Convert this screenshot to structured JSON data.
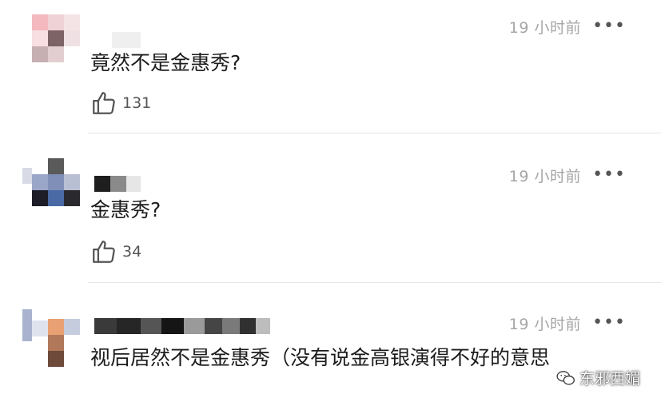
{
  "comments": [
    {
      "time": "19 小时前",
      "more": "•••",
      "text": "竟然不是金惠秀?",
      "likes": "131"
    },
    {
      "time": "19 小时前",
      "more": "•••",
      "text": "金惠秀?",
      "likes": "34"
    },
    {
      "time": "19 小时前",
      "more": "•••",
      "text": "视后居然不是金惠秀（没有说金高银演得不好的意思",
      "likes": ""
    }
  ],
  "watermark": {
    "text": "东邪西媚"
  },
  "colors": {
    "time": "#a6a6a6",
    "text": "#1c1c1c",
    "divider": "#e6e6e6"
  },
  "icons": {
    "like": "thumbs-up-icon",
    "more": "more-icon",
    "watermark": "wechat-logo-icon"
  }
}
